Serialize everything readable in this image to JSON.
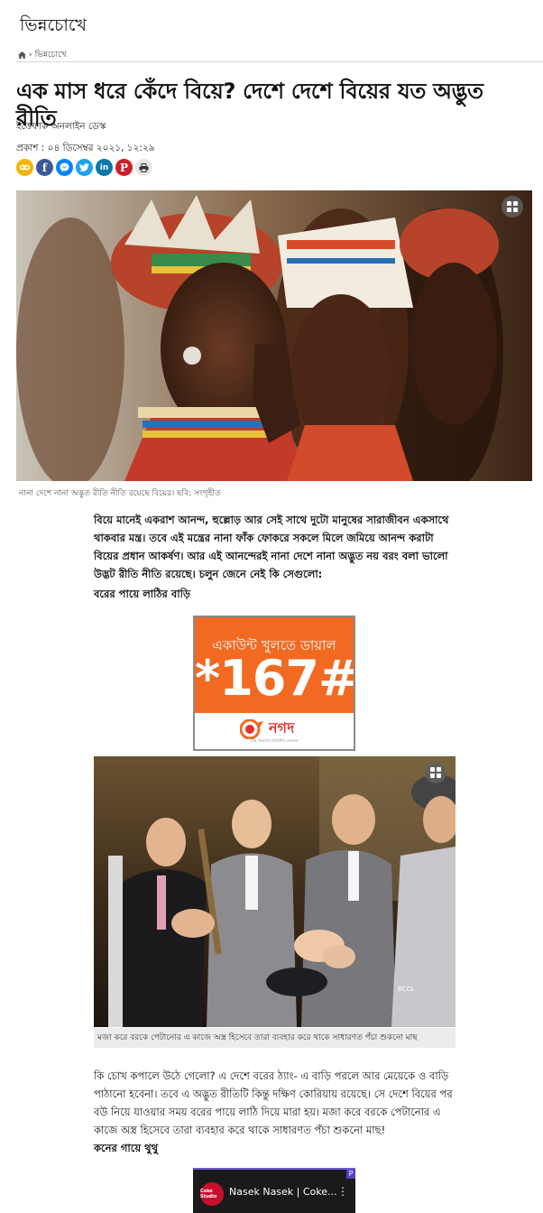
{
  "site": {
    "section_title": "ভিন্নচোখে"
  },
  "breadcrumb": {
    "separator": "›",
    "current": "ভিন্নচোখে",
    "home_icon": "home-icon"
  },
  "article": {
    "headline": "এক মাস ধরে কেঁদে বিয়ে? দেশে দেশে বিয়ের যত অদ্ভুত রীতি",
    "author": "ইত্তেফাক অনলাইন ডেস্ক",
    "published": "প্রকাশ : ০৪ ডিসেম্বর ২০২১, ১২:২৯",
    "share_icons": [
      "link-icon",
      "facebook-icon",
      "messenger-icon",
      "twitter-icon",
      "linkedin-icon",
      "pinterest-icon",
      "print-icon"
    ],
    "hero_caption": "নানা দেশে নানা অদ্ভুত রীতি নীতি রয়েছে বিয়ের। ছবি: সংগৃহীত",
    "intro": "বিয়ে মানেই একরাশ আনন্দ, হুল্লোড় আর সেই সাথে দুটো মানুষের সারাজীবন একসাথে থাকবার মন্ত্র। তবে এই মন্ত্রের নানা ফাঁক ফোকরে সকলে মিলে জমিয়ে আনন্দ করাটা বিয়ের প্রধান আকর্ষণ। আর এই আনন্দেরই নানা দেশে নানা অদ্ভুত নয় বরং বলা ভালো উদ্ভট রীতি নীতি রয়েছে। চলুন জেনে নেই কি সেগুলো:",
    "subhead1": "বরের পায়ে লাঠির বাড়ি",
    "photo2_caption": "মজা করে বরকে পেটানোর এ কাজে অস্ত্র হিসেবে তারা ব্যবহার করে থাকে সাধারণত পঁচা শুকনো মাছ",
    "photo2_credit": "BCCL",
    "para2": "কি চোখ কপালে উঠে গেলো? এ দেশে বরের ঠ্যাং- এ বাড়ি পরলে আর মেয়েকে ও বাড়ি পাঠানো হবেনা। তবে এ অদ্ভুত রীতিটি কিন্তু দক্ষিণ কোরিয়ায় রয়েছে। সে দেশে বিয়ের পর বউ নিয়ে যাওয়ার সময় বরের পায়ে লাঠি দিয়ে মারা হয়। মজা করে বরকে পেটানোর এ কাজে অস্ত্র হিসেবে তারা ব্যবহার করে থাকে সাধারণত পঁচা শুকনো মাছ!",
    "subhead2": "কনের গায়ে থুথু"
  },
  "ad": {
    "line1": "একাউন্ট খুলতে ডায়াল",
    "code": "*167#",
    "brand": "নগদ",
    "brand_sub": "ডাক বিভাগের ডিজিটাল লেনদেন",
    "brand_color": "#f26a21"
  },
  "video": {
    "title": "Nasek Nasek | Coke...",
    "channel_logo": "Coke Studio",
    "menu_icon": "more-vert-icon",
    "badge": "P"
  },
  "colors": {
    "facebook": "#3b5998",
    "messenger": "#0084ff",
    "twitter": "#1da1f2",
    "linkedin": "#0e76a8",
    "pinterest": "#cb2027",
    "link": "#f4b400",
    "print": "#555555"
  }
}
